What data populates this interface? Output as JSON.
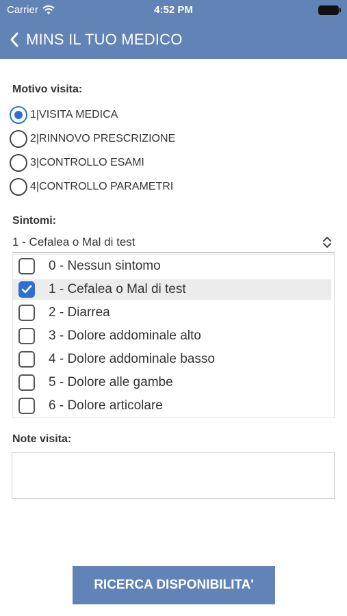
{
  "status_bar": {
    "carrier": "Carrier",
    "time": "4:52 PM"
  },
  "nav": {
    "title": "MINS IL TUO MEDICO",
    "back_icon": "chevron-left-icon"
  },
  "motivo": {
    "label": "Motivo visita:",
    "options": [
      {
        "label": "1|VISITA MEDICA",
        "selected": true
      },
      {
        "label": "2|RINNOVO PRESCRIZIONE",
        "selected": false
      },
      {
        "label": "3|CONTROLLO ESAMI",
        "selected": false
      },
      {
        "label": "4|CONTROLLO PARAMETRI",
        "selected": false
      }
    ]
  },
  "sintomi": {
    "label": "Sintomi:",
    "selected_value": "1 - Cefalea o Mal di test",
    "options": [
      {
        "label": "0 - Nessun sintomo",
        "checked": false
      },
      {
        "label": "1 - Cefalea o Mal di test",
        "checked": true
      },
      {
        "label": "2 - Diarrea",
        "checked": false
      },
      {
        "label": "3 - Dolore addominale alto",
        "checked": false
      },
      {
        "label": "4 - Dolore addominale basso",
        "checked": false
      },
      {
        "label": "5 - Dolore alle gambe",
        "checked": false
      },
      {
        "label": "6 - Dolore articolare",
        "checked": false
      }
    ]
  },
  "note": {
    "label": "Note visita:",
    "value": ""
  },
  "search_button": {
    "label": "RICERCA DISPONIBILITA'"
  },
  "colors": {
    "header": "#6283b6",
    "accent": "#2f6fd0"
  }
}
